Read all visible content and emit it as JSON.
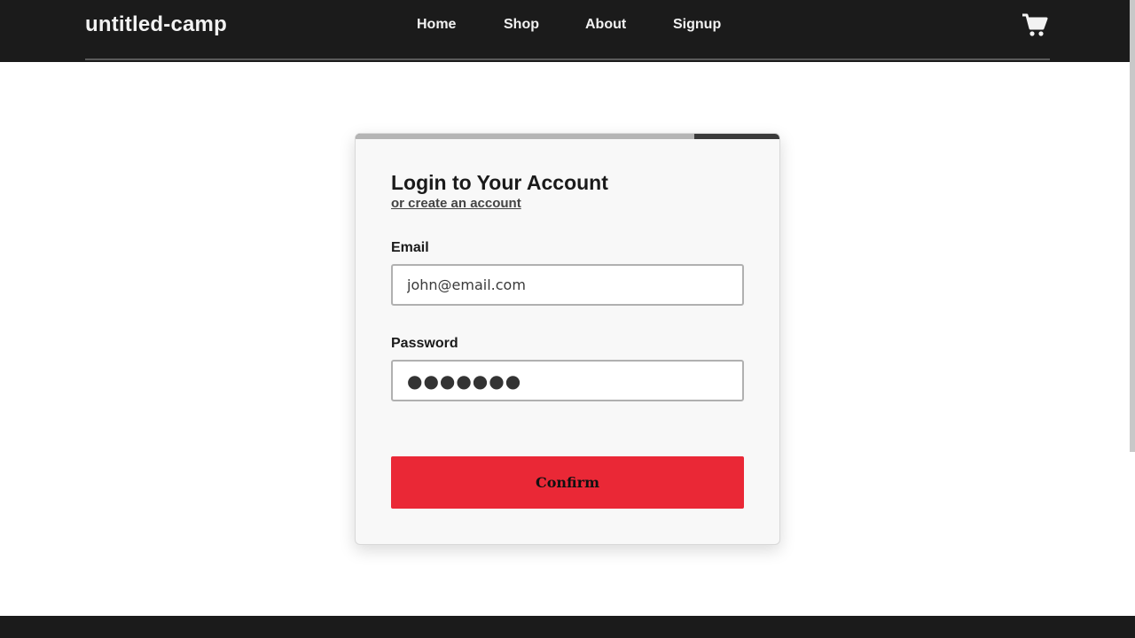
{
  "colors": {
    "navbar_bg": "#1b1b1b",
    "accent_button": "#ea2836",
    "card_bg": "#f8f8f8",
    "progress_fill": "#b5b5b5",
    "progress_track": "#3a3a3a"
  },
  "header": {
    "brand": "untitled-camp",
    "nav": [
      {
        "label": "Home"
      },
      {
        "label": "Shop"
      },
      {
        "label": "About"
      },
      {
        "label": "Signup"
      }
    ],
    "cart_icon": "shopping-cart-icon"
  },
  "login": {
    "progress": 0.8,
    "title": "Login to Your Account",
    "create_link": "or create an account",
    "email": {
      "label": "Email",
      "value": "john@email.com"
    },
    "password": {
      "label": "Password",
      "value": "●●●●●●●"
    },
    "confirm_label": "Confirm"
  }
}
